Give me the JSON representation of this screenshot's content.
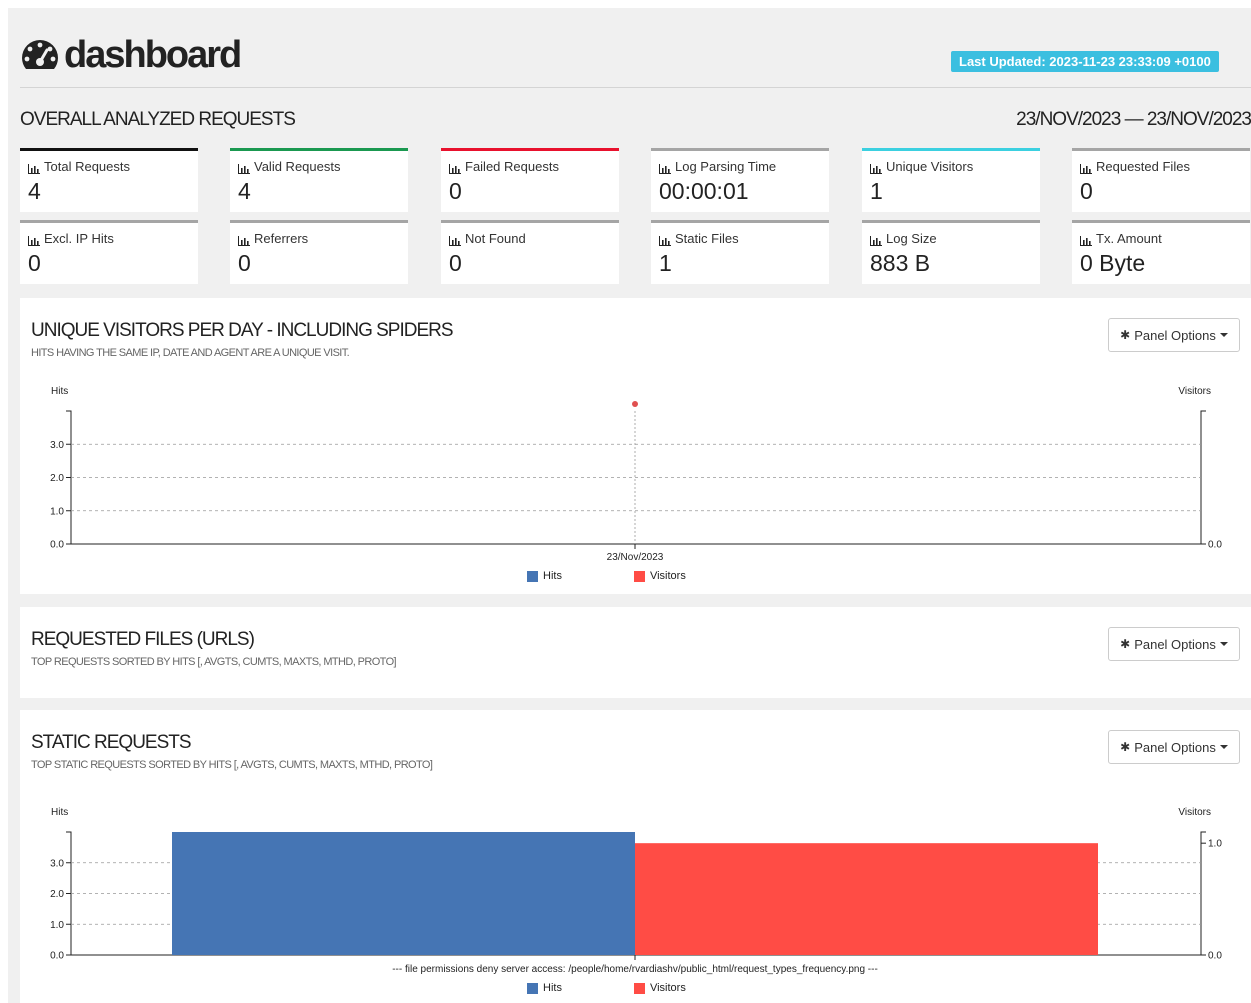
{
  "header": {
    "title": "dashboard",
    "last_updated": "Last Updated: 2023-11-23 23:33:09 +0100"
  },
  "overall": {
    "title": "OVERALL ANALYZED REQUESTS",
    "date_range": "23/NOV/2023 — 23/NOV/2023",
    "cards": [
      {
        "label": "Total Requests",
        "value": "4",
        "color": "#111111"
      },
      {
        "label": "Valid Requests",
        "value": "4",
        "color": "#1a9850"
      },
      {
        "label": "Failed Requests",
        "value": "0",
        "color": "#e8112d"
      },
      {
        "label": "Log Parsing Time",
        "value": "00:00:01",
        "color": "#a5a5a5"
      },
      {
        "label": "Unique Visitors",
        "value": "1",
        "color": "#3bd0e0"
      },
      {
        "label": "Requested Files",
        "value": "0",
        "color": "#a5a5a5"
      },
      {
        "label": "Excl. IP Hits",
        "value": "0",
        "color": "#a5a5a5"
      },
      {
        "label": "Referrers",
        "value": "0",
        "color": "#a5a5a5"
      },
      {
        "label": "Not Found",
        "value": "0",
        "color": "#a5a5a5"
      },
      {
        "label": "Static Files",
        "value": "1",
        "color": "#a5a5a5"
      },
      {
        "label": "Log Size",
        "value": "883 B",
        "color": "#a5a5a5"
      },
      {
        "label": "Tx. Amount",
        "value": "0 Byte",
        "color": "#a5a5a5"
      }
    ]
  },
  "panels": {
    "visitors": {
      "title": "UNIQUE VISITORS PER DAY - INCLUDING SPIDERS",
      "subtitle": "HITS HAVING THE SAME IP, DATE AND AGENT ARE A UNIQUE VISIT.",
      "options_label": "Panel Options"
    },
    "requests": {
      "title": "REQUESTED FILES (URLS)",
      "subtitle": "TOP REQUESTS SORTED BY HITS [, AVGTS, CUMTS, MAXTS, MTHD, PROTO]",
      "options_label": "Panel Options"
    },
    "static": {
      "title": "STATIC REQUESTS",
      "subtitle": "TOP STATIC REQUESTS SORTED BY HITS [, AVGTS, CUMTS, MAXTS, MTHD, PROTO]",
      "options_label": "Panel Options"
    }
  },
  "chart_data": [
    {
      "type": "line",
      "categories": [
        "23/Nov/2023"
      ],
      "series": [
        {
          "name": "Hits",
          "values": [
            4
          ],
          "color": "#4575b4"
        },
        {
          "name": "Visitors",
          "values": [
            1
          ],
          "color": "#e05050"
        }
      ],
      "ylabel": "Hits",
      "y2label": "Visitors",
      "y_ticks": [
        "0.0",
        "1.0",
        "2.0",
        "3.0"
      ],
      "y2_ticks": [
        "0.0"
      ],
      "ylim": [
        0,
        4
      ],
      "y2lim": [
        0,
        1
      ],
      "grid": true,
      "legend": "bottom"
    },
    {
      "type": "bar",
      "categories": [
        "--- file permissions deny server access: /people/home/rvardiashv/public_html/request_types_frequency.png ---"
      ],
      "series": [
        {
          "name": "Hits",
          "values": [
            4
          ],
          "color": "#4575b4"
        },
        {
          "name": "Visitors",
          "values": [
            1
          ],
          "color": "#ff4c45"
        }
      ],
      "ylabel": "Hits",
      "y2label": "Visitors",
      "y_ticks": [
        "0.0",
        "1.0",
        "2.0",
        "3.0"
      ],
      "y2_ticks": [
        "0.0",
        "1.0"
      ],
      "ylim": [
        0,
        4
      ],
      "y2lim": [
        0,
        1.1
      ],
      "grid": true,
      "legend": "bottom"
    }
  ]
}
